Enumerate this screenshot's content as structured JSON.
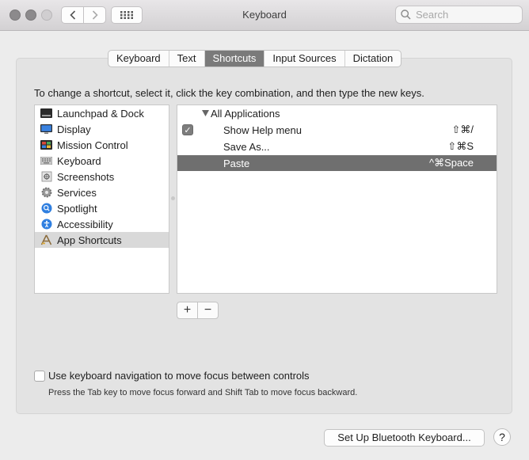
{
  "window": {
    "title": "Keyboard"
  },
  "search": {
    "placeholder": "Search"
  },
  "tabs": [
    "Keyboard",
    "Text",
    "Shortcuts",
    "Input Sources",
    "Dictation"
  ],
  "active_tab": "Shortcuts",
  "instruction": "To change a shortcut, select it, click the key combination, and then type the new keys.",
  "categories": [
    {
      "label": "Launchpad & Dock",
      "icon": "launchpad-dock-icon"
    },
    {
      "label": "Display",
      "icon": "display-icon"
    },
    {
      "label": "Mission Control",
      "icon": "mission-control-icon"
    },
    {
      "label": "Keyboard",
      "icon": "keyboard-icon"
    },
    {
      "label": "Screenshots",
      "icon": "screenshots-icon"
    },
    {
      "label": "Services",
      "icon": "services-gear-icon"
    },
    {
      "label": "Spotlight",
      "icon": "spotlight-icon"
    },
    {
      "label": "Accessibility",
      "icon": "accessibility-icon"
    },
    {
      "label": "App Shortcuts",
      "icon": "app-shortcuts-icon",
      "selected": true
    }
  ],
  "shortcuts": {
    "group_label": "All Applications",
    "items": [
      {
        "label": "Show Help menu",
        "keys": "⇧⌘/",
        "checked": true
      },
      {
        "label": "Save As...",
        "keys": "⇧⌘S",
        "checked": false
      },
      {
        "label": "Paste",
        "keys": "^⌘Space",
        "checked": false,
        "selected": true
      }
    ]
  },
  "buttons": {
    "add": "+",
    "remove": "−",
    "bluetooth": "Set Up Bluetooth Keyboard...",
    "help": "?"
  },
  "keyboard_nav": {
    "label": "Use keyboard navigation to move focus between controls",
    "checked": false,
    "help": "Press the Tab key to move focus forward and Shift Tab to move focus backward."
  },
  "colors": {
    "selected_row": "#6f6f6f",
    "active_tab": "#7a7a7a"
  }
}
